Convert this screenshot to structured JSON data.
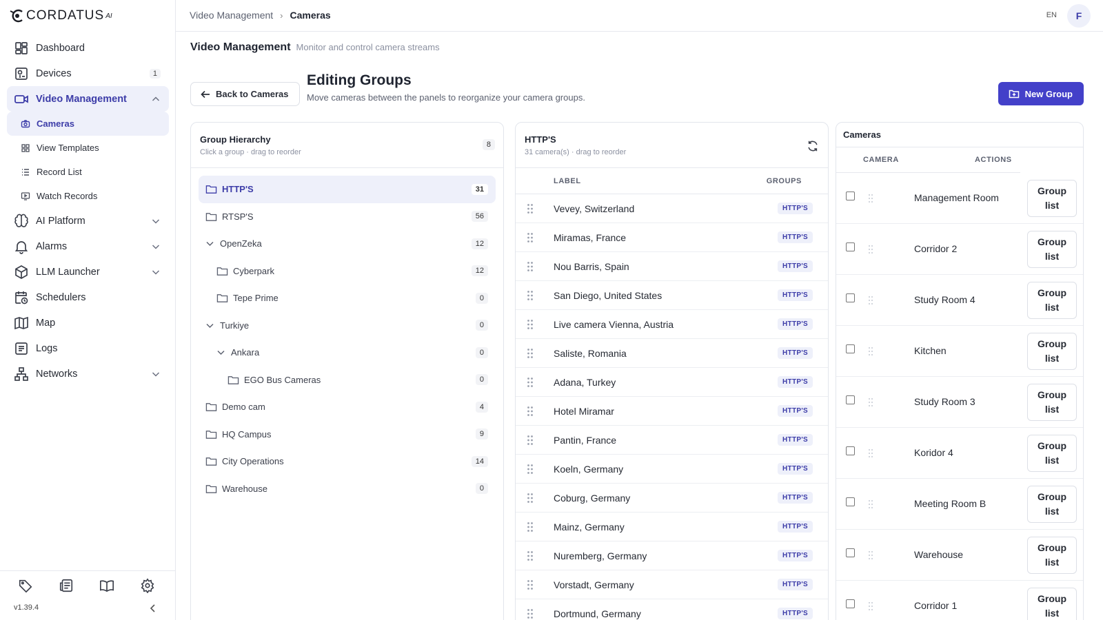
{
  "brand": {
    "name": "CORDATUS",
    "suffix": "AI"
  },
  "sidebar": {
    "items": [
      {
        "label": "Dashboard",
        "icon": "dashboard-icon"
      },
      {
        "label": "Devices",
        "icon": "devices-icon",
        "badge": "1"
      },
      {
        "label": "Video Management",
        "icon": "video-icon",
        "active": true,
        "expanded": true
      },
      {
        "label": "AI Platform",
        "icon": "brain-icon"
      },
      {
        "label": "Alarms",
        "icon": "bell-icon"
      },
      {
        "label": "LLM Launcher",
        "icon": "cube-icon"
      },
      {
        "label": "Schedulers",
        "icon": "calendar-clock-icon"
      },
      {
        "label": "Map",
        "icon": "map-icon"
      },
      {
        "label": "Logs",
        "icon": "logs-icon"
      },
      {
        "label": "Networks",
        "icon": "network-icon"
      }
    ],
    "sub_items": [
      {
        "label": "Cameras",
        "active": true
      },
      {
        "label": "View Templates"
      },
      {
        "label": "Record List"
      },
      {
        "label": "Watch Records"
      }
    ],
    "version": "v1.39.4"
  },
  "topbar": {
    "crumb_parent": "Video Management",
    "crumb_current": "Cameras",
    "lang": "EN",
    "avatar": "F"
  },
  "page": {
    "title": "Video Management",
    "subtitle": "Monitor and control camera streams",
    "back_label": "Back to Cameras",
    "edit_title": "Editing Groups",
    "edit_subtitle": "Move cameras between the panels to reorganize your camera groups.",
    "new_group_label": "New Group"
  },
  "hierarchy": {
    "title": "Group Hierarchy",
    "subtitle": "Click a group · drag to reorder",
    "count": "8",
    "groups": [
      {
        "label": "HTTP'S",
        "count": "31",
        "level": 0,
        "type": "folder",
        "selected": true
      },
      {
        "label": "RTSP'S",
        "count": "56",
        "level": 0,
        "type": "folder"
      },
      {
        "label": "OpenZeka",
        "count": "12",
        "level": 0,
        "type": "expanded"
      },
      {
        "label": "Cyberpark",
        "count": "12",
        "level": 1,
        "type": "folder"
      },
      {
        "label": "Tepe Prime",
        "count": "0",
        "level": 1,
        "type": "folder"
      },
      {
        "label": "Turkiye",
        "count": "0",
        "level": 0,
        "type": "expanded"
      },
      {
        "label": "Ankara",
        "count": "0",
        "level": 1,
        "type": "expanded"
      },
      {
        "label": "EGO Bus Cameras",
        "count": "0",
        "level": 2,
        "type": "folder"
      },
      {
        "label": "Demo cam",
        "count": "4",
        "level": 0,
        "type": "folder"
      },
      {
        "label": "HQ Campus",
        "count": "9",
        "level": 0,
        "type": "folder"
      },
      {
        "label": "City Operations",
        "count": "14",
        "level": 0,
        "type": "folder"
      },
      {
        "label": "Warehouse",
        "count": "0",
        "level": 0,
        "type": "folder"
      }
    ]
  },
  "group_panel": {
    "title": "HTTP'S",
    "subtitle": "31 camera(s) · drag to reorder",
    "col_label": "LABEL",
    "col_groups": "GROUPS",
    "tag": "HTTP'S",
    "cameras": [
      "Vevey, Switzerland",
      "Miramas, France",
      "Nou Barris, Spain",
      "San Diego, United States",
      "Live camera Vienna, Austria",
      "Saliste, Romania",
      "Adana, Turkey",
      "Hotel Miramar",
      "Pantin, France",
      "Koeln, Germany",
      "Coburg, Germany",
      "Mainz, Germany",
      "Nuremberg, Germany",
      "Vorstadt, Germany",
      "Dortmund, Germany"
    ]
  },
  "cameras_panel": {
    "title": "Cameras",
    "col_camera": "CAMERA",
    "col_actions": "ACTIONS",
    "action_label": "Group list",
    "rows": [
      "Management Room",
      "Corridor 2",
      "Study Room 4",
      "Kitchen",
      "Study Room 3",
      "Koridor 4",
      "Meeting Room B",
      "Warehouse",
      "Corridor 1"
    ]
  },
  "colors": {
    "accent": "#4340c9",
    "selected_bg": "#eef0fa",
    "accent_text": "#3c3ca8"
  }
}
